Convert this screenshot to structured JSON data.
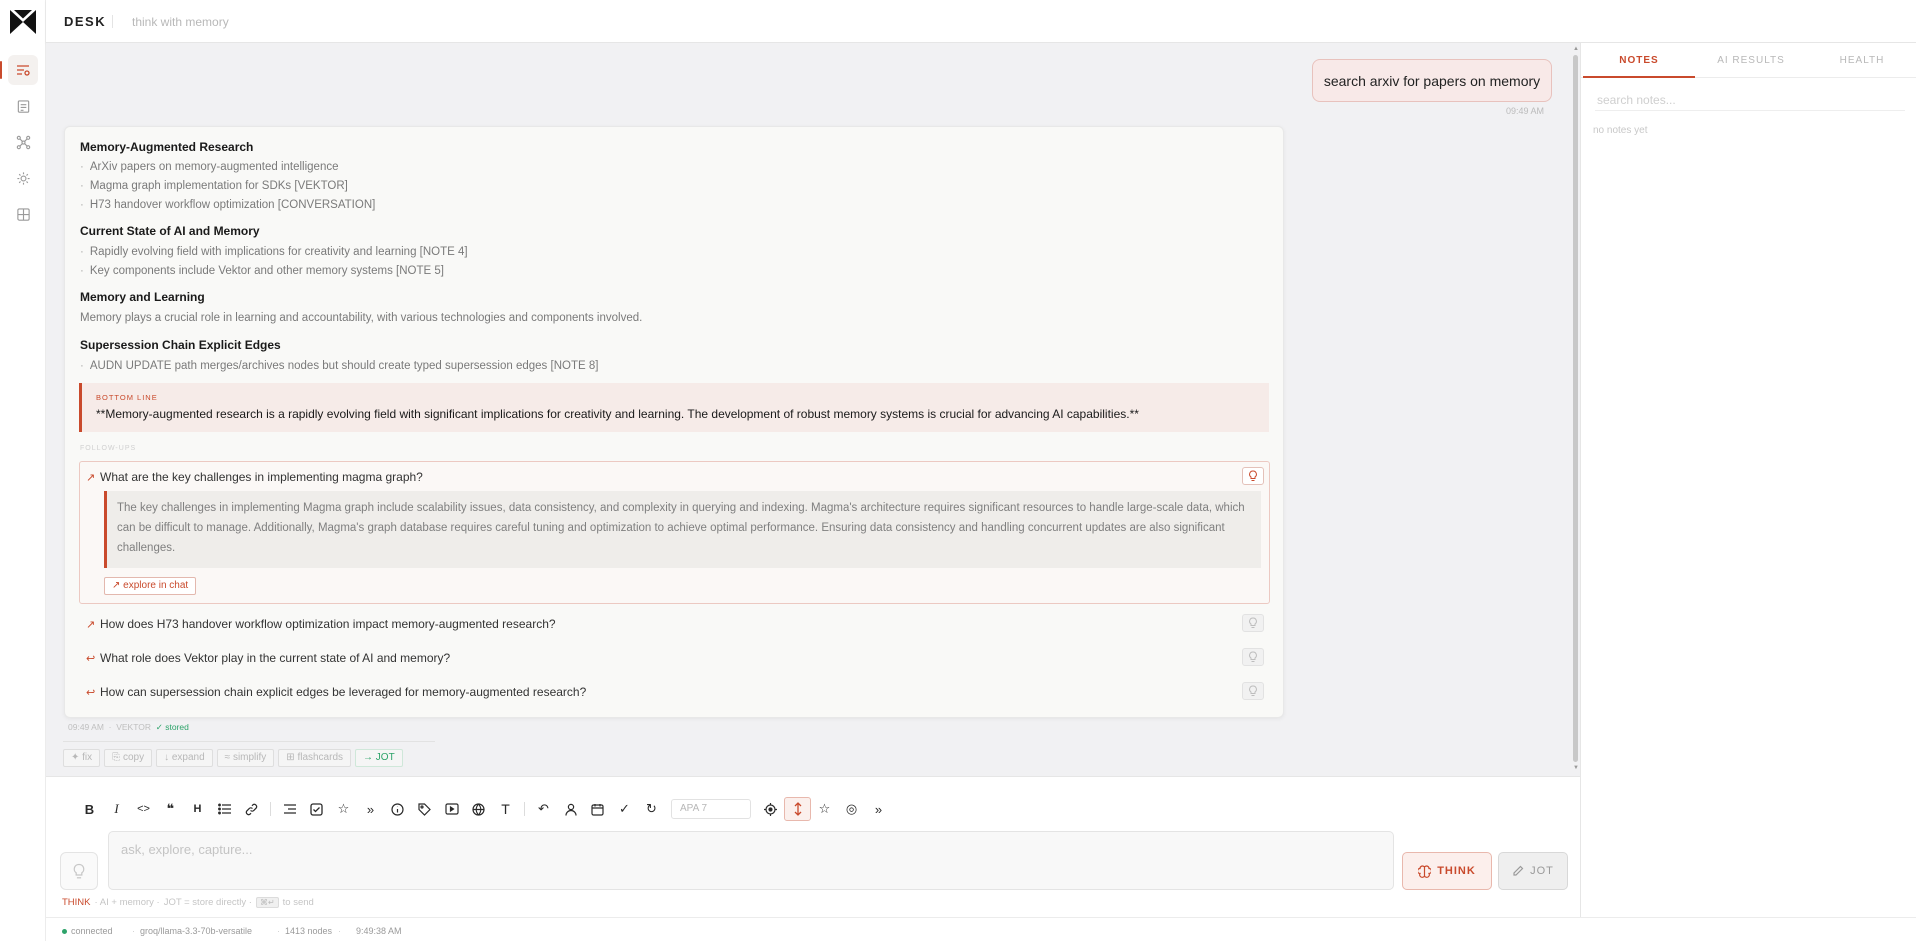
{
  "app": {
    "brand": "DESK",
    "tagline": "think with memory"
  },
  "rail": {
    "items": [
      "chat-icon",
      "notes-icon",
      "graph-icon",
      "insights-icon",
      "modules-icon"
    ],
    "active_index": 0
  },
  "chat": {
    "user_message": {
      "text": "search arxiv for papers on memory",
      "time": "09:49 AM"
    },
    "ai": {
      "sections": [
        {
          "heading": "Memory-Augmented Research",
          "bullets": [
            "ArXiv papers on memory-augmented intelligence",
            "Magma graph implementation for SDKs [VEKTOR]",
            "H73 handover workflow optimization [CONVERSATION]"
          ]
        },
        {
          "heading": "Current State of AI and Memory",
          "bullets": [
            "Rapidly evolving field with implications for creativity and learning [NOTE 4]",
            "Key components include Vektor and other memory systems [NOTE 5]"
          ]
        },
        {
          "heading": "Memory and Learning",
          "paragraph": "Memory plays a crucial role in learning and accountability, with various technologies and components involved."
        },
        {
          "heading": "Supersession Chain Explicit Edges",
          "bullets": [
            "AUDN UPDATE path merges/archives nodes but should create typed supersession edges [NOTE 8]"
          ]
        }
      ],
      "bottom_line": {
        "label": "BOTTOM LINE",
        "text": "**Memory-augmented research is a rapidly evolving field with significant implications for creativity and learning. The development of robust memory systems is crucial for advancing AI capabilities.**"
      },
      "followups_label": "FOLLOW-UPS",
      "followups": [
        {
          "question": "What are the key challenges in implementing magma graph?",
          "arrow": "↗",
          "expanded": true,
          "answer": "The key challenges in implementing Magma graph include scalability issues, data consistency, and complexity in querying and indexing. Magma's architecture requires significant resources to handle large-scale data, which can be difficult to manage. Additionally, Magma's graph database requires careful tuning and optimization to achieve optimal performance. Ensuring data consistency and handling concurrent updates are also significant challenges.",
          "explore_label": "↗ explore in chat"
        },
        {
          "question": "How does H73 handover workflow optimization impact memory-augmented research?",
          "arrow": "↗"
        },
        {
          "question": "What role does Vektor play in the current state of AI and memory?",
          "arrow": "↩"
        },
        {
          "question": "How can supersession chain explicit edges be leveraged for memory-augmented research?",
          "arrow": "↩"
        }
      ],
      "meta": {
        "time": "09:49 AM",
        "source": "VEKTOR",
        "stored": "✓ stored"
      }
    },
    "actions": [
      "✦ fix",
      "⎘ copy",
      "↓ expand",
      "≈ simplify",
      "⊞ flashcards",
      "→ JOT"
    ]
  },
  "composer": {
    "citation_style": "APA 7",
    "placeholder": "ask, explore, capture...",
    "think_label": "THINK",
    "jot_label": "JOT",
    "hint": {
      "think": "THINK",
      "think_desc": "· AI + memory ·",
      "jot_desc": "JOT = store directly ·",
      "kbd": "⌘↵",
      "send": "to send"
    }
  },
  "right_panel": {
    "tabs": [
      "NOTES",
      "AI RESULTS",
      "HEALTH"
    ],
    "active_tab": 0,
    "search_placeholder": "search notes...",
    "empty_text": "no notes yet"
  },
  "status": {
    "connection": "connected",
    "model": "groq/llama-3.3-70b-versatile",
    "nodes": "1413 nodes",
    "time": "9:49:38 AM"
  },
  "colors": {
    "accent": "#c94a2c",
    "success": "#2ea36a",
    "chat_bg": "#f1f1f3"
  }
}
